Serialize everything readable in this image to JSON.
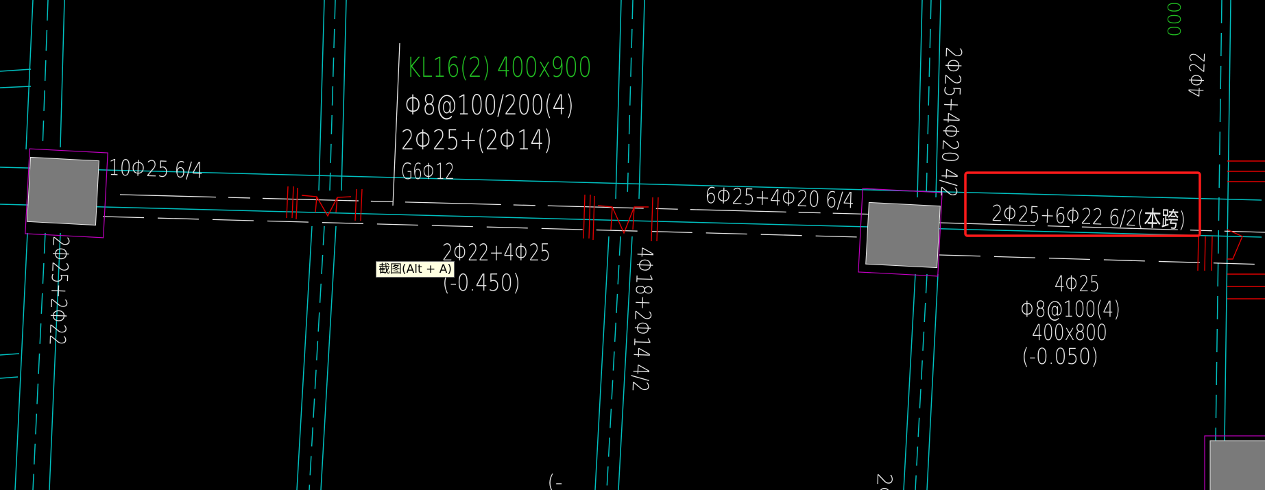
{
  "colors": {
    "background": "#000000",
    "axis_line": "#00c0c0",
    "beam_edge": "#e8e8e8",
    "column_fill": "#7a7a7a",
    "column_outline": "#c000c0",
    "rebar_red": "#e00000",
    "highlight_box": "#ff1a1a",
    "beam_name_green": "#22c022",
    "annotation_text": "#e8e8e8"
  },
  "tooltip": {
    "label": "截图(Alt + A)"
  },
  "beam_kl16": {
    "name": "KL16(2) 400x900",
    "stirrups": "Φ8@100/200(4)",
    "longitudinal": "2Φ25+(2Φ14)",
    "side_bars": "G6Φ12"
  },
  "labels": {
    "left_support_top": "10Φ25 6/4",
    "left_column_vertical": "2Φ25+2Φ22",
    "span_bottom": "2Φ22+4Φ25",
    "span_bottom_elevation": "(-0.450)",
    "mid_vertical": "4Φ18+2Φ14 4/2",
    "right_support_top": "6Φ25+4Φ20 6/4",
    "right_column_vertical": "2Φ25+4Φ20 4/2",
    "highlighted_annotation": "2Φ25+6Φ22 6/2(本跨)",
    "right_bars": "4Φ25",
    "right_stirrups": "Φ8@100(4)",
    "right_section": "400x800",
    "right_elevation": "(-0.050)",
    "far_right_vertical": "4Φ22",
    "top_right_green": "000",
    "bottom_partial_left": "(-",
    "bottom_partial_mid": "2Φ"
  }
}
